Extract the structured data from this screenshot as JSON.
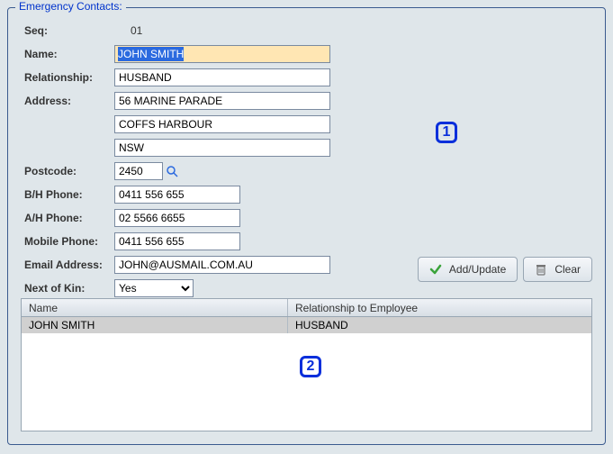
{
  "legend": "Emergency Contacts:",
  "seq": {
    "label": "Seq:",
    "value": "01"
  },
  "name": {
    "label": "Name:",
    "value": "JOHN SMITH"
  },
  "relationship": {
    "label": "Relationship:",
    "value": "HUSBAND"
  },
  "address": {
    "label": "Address:",
    "line1": "56 MARINE PARADE",
    "line2": "COFFS HARBOUR",
    "line3": "NSW"
  },
  "postcode": {
    "label": "Postcode:",
    "value": "2450"
  },
  "bh_phone": {
    "label": "B/H Phone:",
    "value": "0411 556 655"
  },
  "ah_phone": {
    "label": "A/H Phone:",
    "value": "02 5566 6655"
  },
  "mobile": {
    "label": "Mobile Phone:",
    "value": "0411 556 655"
  },
  "email": {
    "label": "Email Address:",
    "value": "JOHN@AUSMAIL.COM.AU"
  },
  "next_of_kin": {
    "label": "Next of Kin:",
    "value": "Yes"
  },
  "buttons": {
    "add_update": "Add/Update",
    "clear": "Clear"
  },
  "table": {
    "headers": {
      "name": "Name",
      "rel": "Relationship to Employee"
    },
    "rows": [
      {
        "name": "JOHN SMITH",
        "rel": "HUSBAND"
      }
    ]
  },
  "callouts": {
    "one": "1",
    "two": "2"
  }
}
